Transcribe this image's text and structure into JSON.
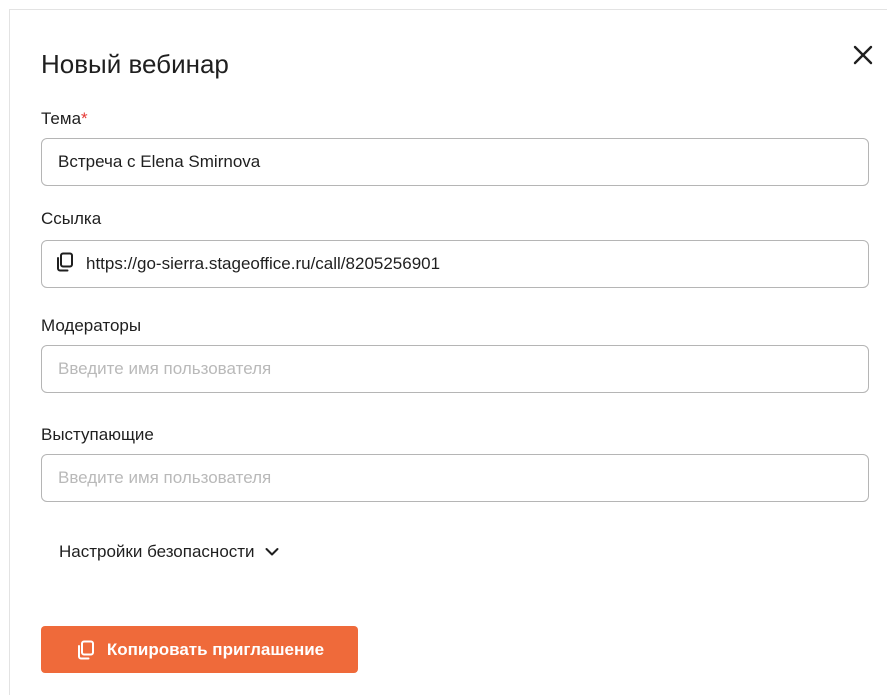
{
  "dialog": {
    "title": "Новый вебинар",
    "close_icon": "close-icon"
  },
  "fields": {
    "topic": {
      "label": "Тема",
      "required_mark": "*",
      "value": "Встреча с Elena Smirnova"
    },
    "link": {
      "label": "Ссылка",
      "icon": "copy-icon",
      "value": "https://go-sierra.stageoffice.ru/call/8205256901"
    },
    "moderators": {
      "label": "Модераторы",
      "placeholder": "Введите имя пользователя"
    },
    "speakers": {
      "label": "Выступающие",
      "placeholder": "Введите имя пользователя"
    }
  },
  "security": {
    "label": "Настройки безопасности",
    "icon": "chevron-down-icon"
  },
  "actions": {
    "copy_invite_label": "Копировать приглашение",
    "copy_invite_icon": "copy-icon"
  },
  "colors": {
    "accent": "#ef6a3a",
    "required": "#e53935",
    "border": "#b5b5b5",
    "placeholder": "#b9b9b9"
  }
}
